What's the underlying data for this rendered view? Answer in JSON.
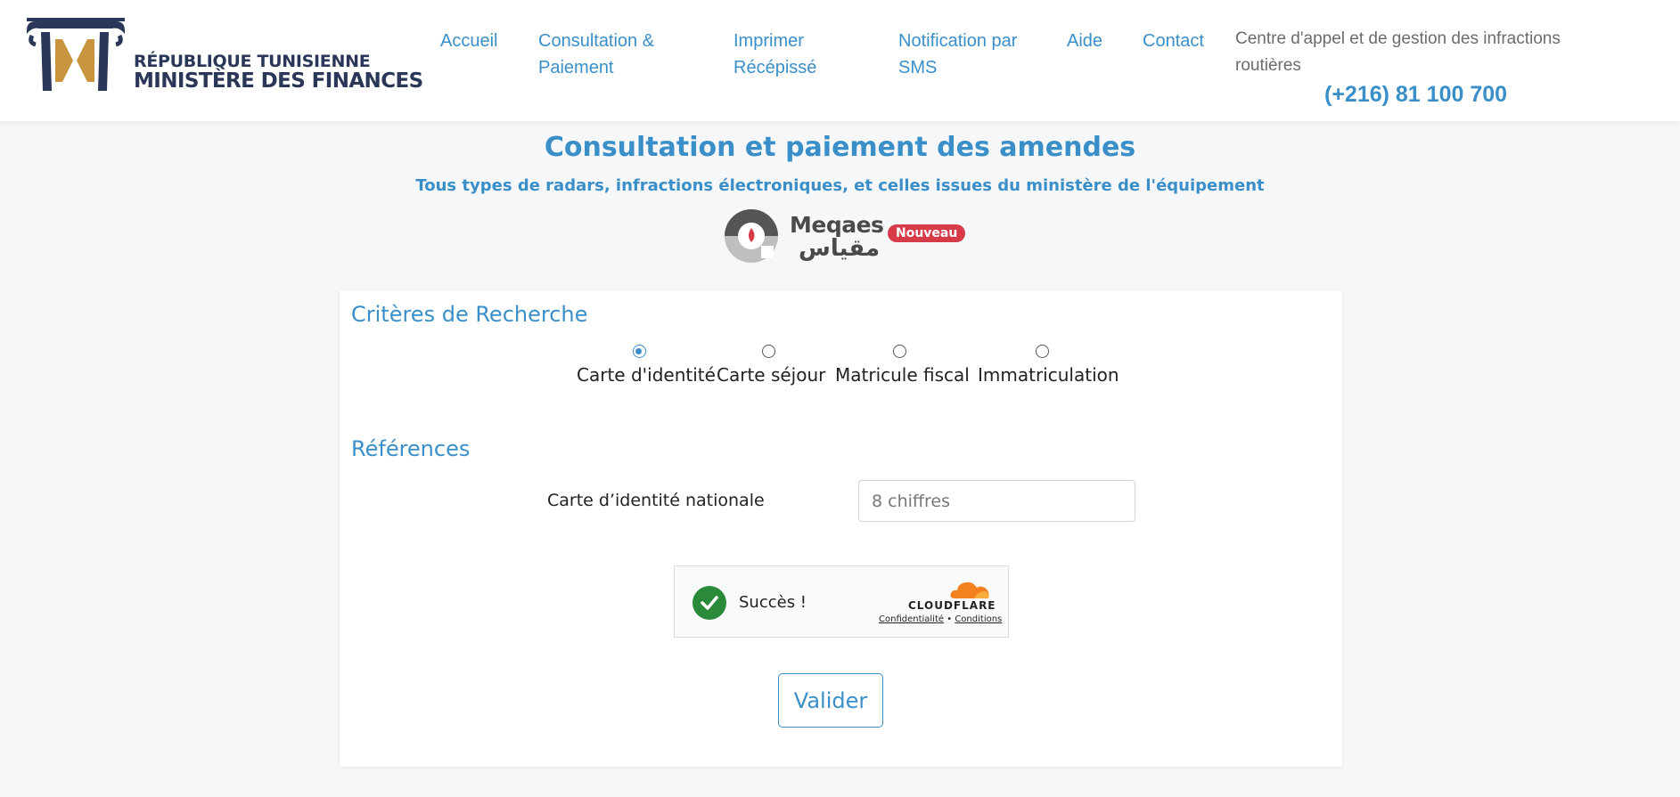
{
  "header": {
    "logo": {
      "line1": "RÉPUBLIQUE TUNISIENNE",
      "line2": "MINISTÈRE DES FINANCES",
      "colors": {
        "navy": "#2b3758",
        "gold": "#c8953e"
      }
    },
    "nav": [
      {
        "label": "Accueil"
      },
      {
        "label": "Consultation &",
        "label2": "Paiement"
      },
      {
        "label": "Imprimer",
        "label2": "Récépissé"
      },
      {
        "label": "Notification par",
        "label2": "SMS"
      },
      {
        "label": "Aide"
      },
      {
        "label": "Contact"
      }
    ],
    "call_center": "Centre d'appel et de gestion des infractions routières",
    "phone": "(+216) 81 100 700"
  },
  "page": {
    "title": "Consultation et paiement des amendes",
    "subtitle": "Tous types de radars, infractions électroniques, et celles issues du ministère de l'équipement",
    "promo": {
      "brand": "Meqaes",
      "brand_ar": "مقياس",
      "badge": "Nouveau"
    }
  },
  "search": {
    "title": "Critères de Recherche",
    "options": [
      {
        "label": "Carte d'identité",
        "checked": true
      },
      {
        "label": "Carte séjour",
        "checked": false
      },
      {
        "label": "Matricule fiscal",
        "checked": false
      },
      {
        "label": "Immatriculation",
        "checked": false
      }
    ]
  },
  "references": {
    "title": "Références",
    "field_label": "Carte d’identité nationale",
    "field_value": "",
    "field_placeholder": "8 chiffres"
  },
  "captcha": {
    "status": "Succès !",
    "provider": "CLOUDFLARE",
    "privacy": "Confidentialité",
    "separator": "•",
    "terms": "Conditions"
  },
  "submit_label": "Valider",
  "colors": {
    "accent": "#3a8fc9",
    "badge": "#d63b47",
    "success": "#2a8a3a",
    "cloudflare": "#f48120"
  }
}
